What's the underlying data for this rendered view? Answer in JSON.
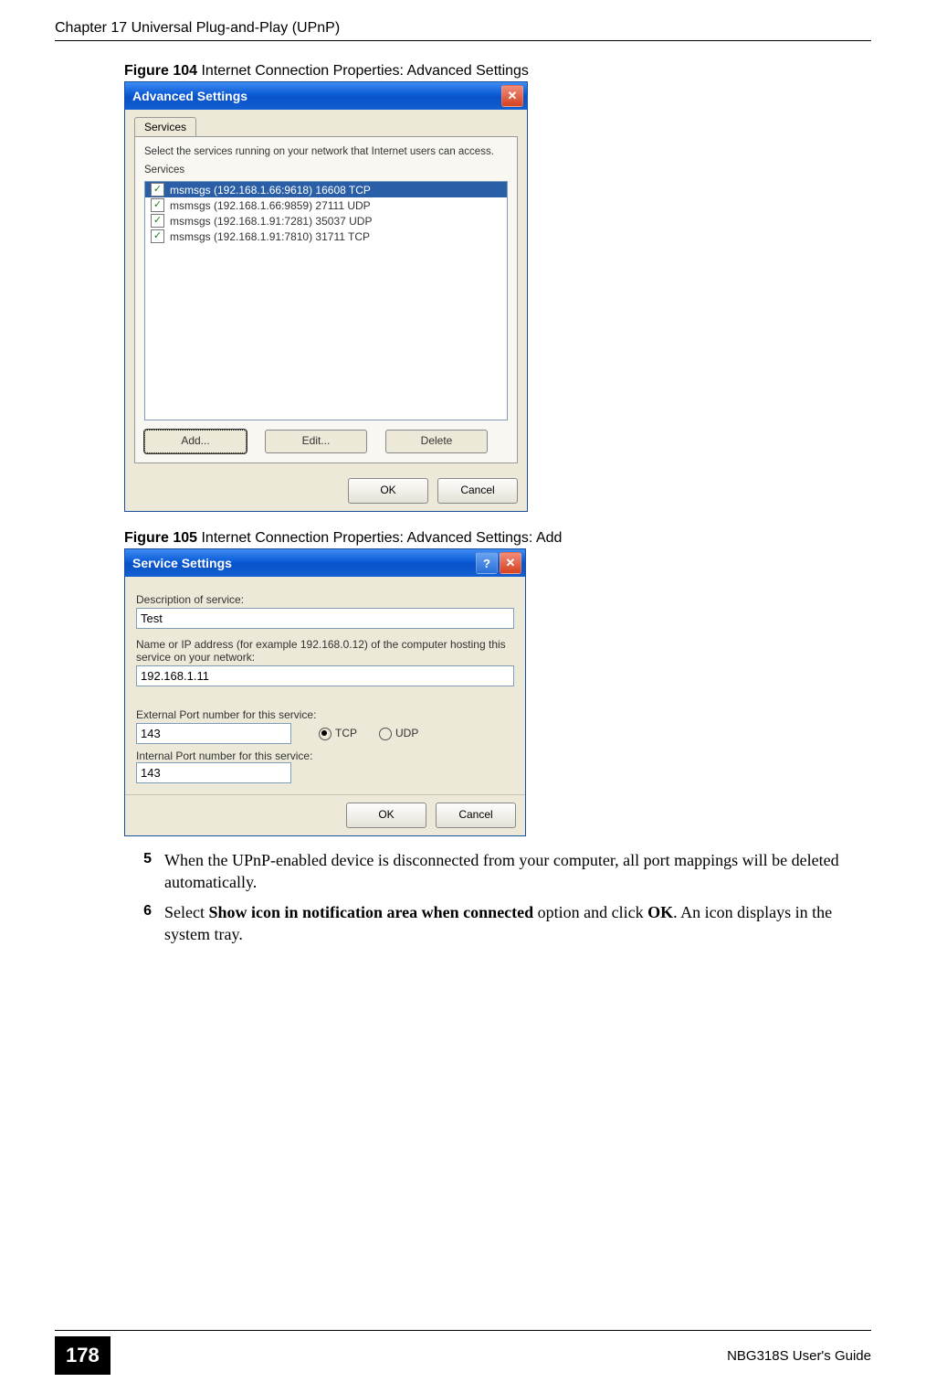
{
  "header": "Chapter 17 Universal Plug-and-Play (UPnP)",
  "fig104": {
    "caption_bold": "Figure 104   ",
    "caption_rest": "Internet Connection Properties: Advanced Settings",
    "title": "Advanced Settings",
    "tab": "Services",
    "instruction": "Select the services running on your network that Internet users can access.",
    "group_label": "Services",
    "items": [
      "msmsgs (192.168.1.66:9618) 16608 TCP",
      "msmsgs (192.168.1.66:9859) 27111 UDP",
      "msmsgs (192.168.1.91:7281) 35037 UDP",
      "msmsgs (192.168.1.91:7810) 31711 TCP"
    ],
    "btn_add": "Add...",
    "btn_edit": "Edit...",
    "btn_delete": "Delete",
    "btn_ok": "OK",
    "btn_cancel": "Cancel"
  },
  "fig105": {
    "caption_bold": "Figure 105   ",
    "caption_rest": "Internet Connection Properties: Advanced Settings: Add",
    "title": "Service Settings",
    "label_desc": "Description of service:",
    "val_desc": "Test",
    "label_host": "Name or IP address (for example 192.168.0.12) of the computer hosting this service on your network:",
    "val_host": "192.168.1.11",
    "label_ext": "External Port number for this service:",
    "val_ext": "143",
    "radio_tcp": "TCP",
    "radio_udp": "UDP",
    "label_int": "Internal Port number for this service:",
    "val_int": "143",
    "btn_ok": "OK",
    "btn_cancel": "Cancel"
  },
  "steps": {
    "s5num": "5",
    "s5": "When the UPnP-enabled device is disconnected from your computer, all port mappings will be deleted automatically.",
    "s6num": "6",
    "s6_pre": "Select ",
    "s6_bold": "Show icon in notification area when connected",
    "s6_mid": " option and click ",
    "s6_ok": "OK",
    "s6_post": ". An icon displays in the system tray."
  },
  "footer": {
    "page": "178",
    "guide": "NBG318S User's Guide"
  }
}
